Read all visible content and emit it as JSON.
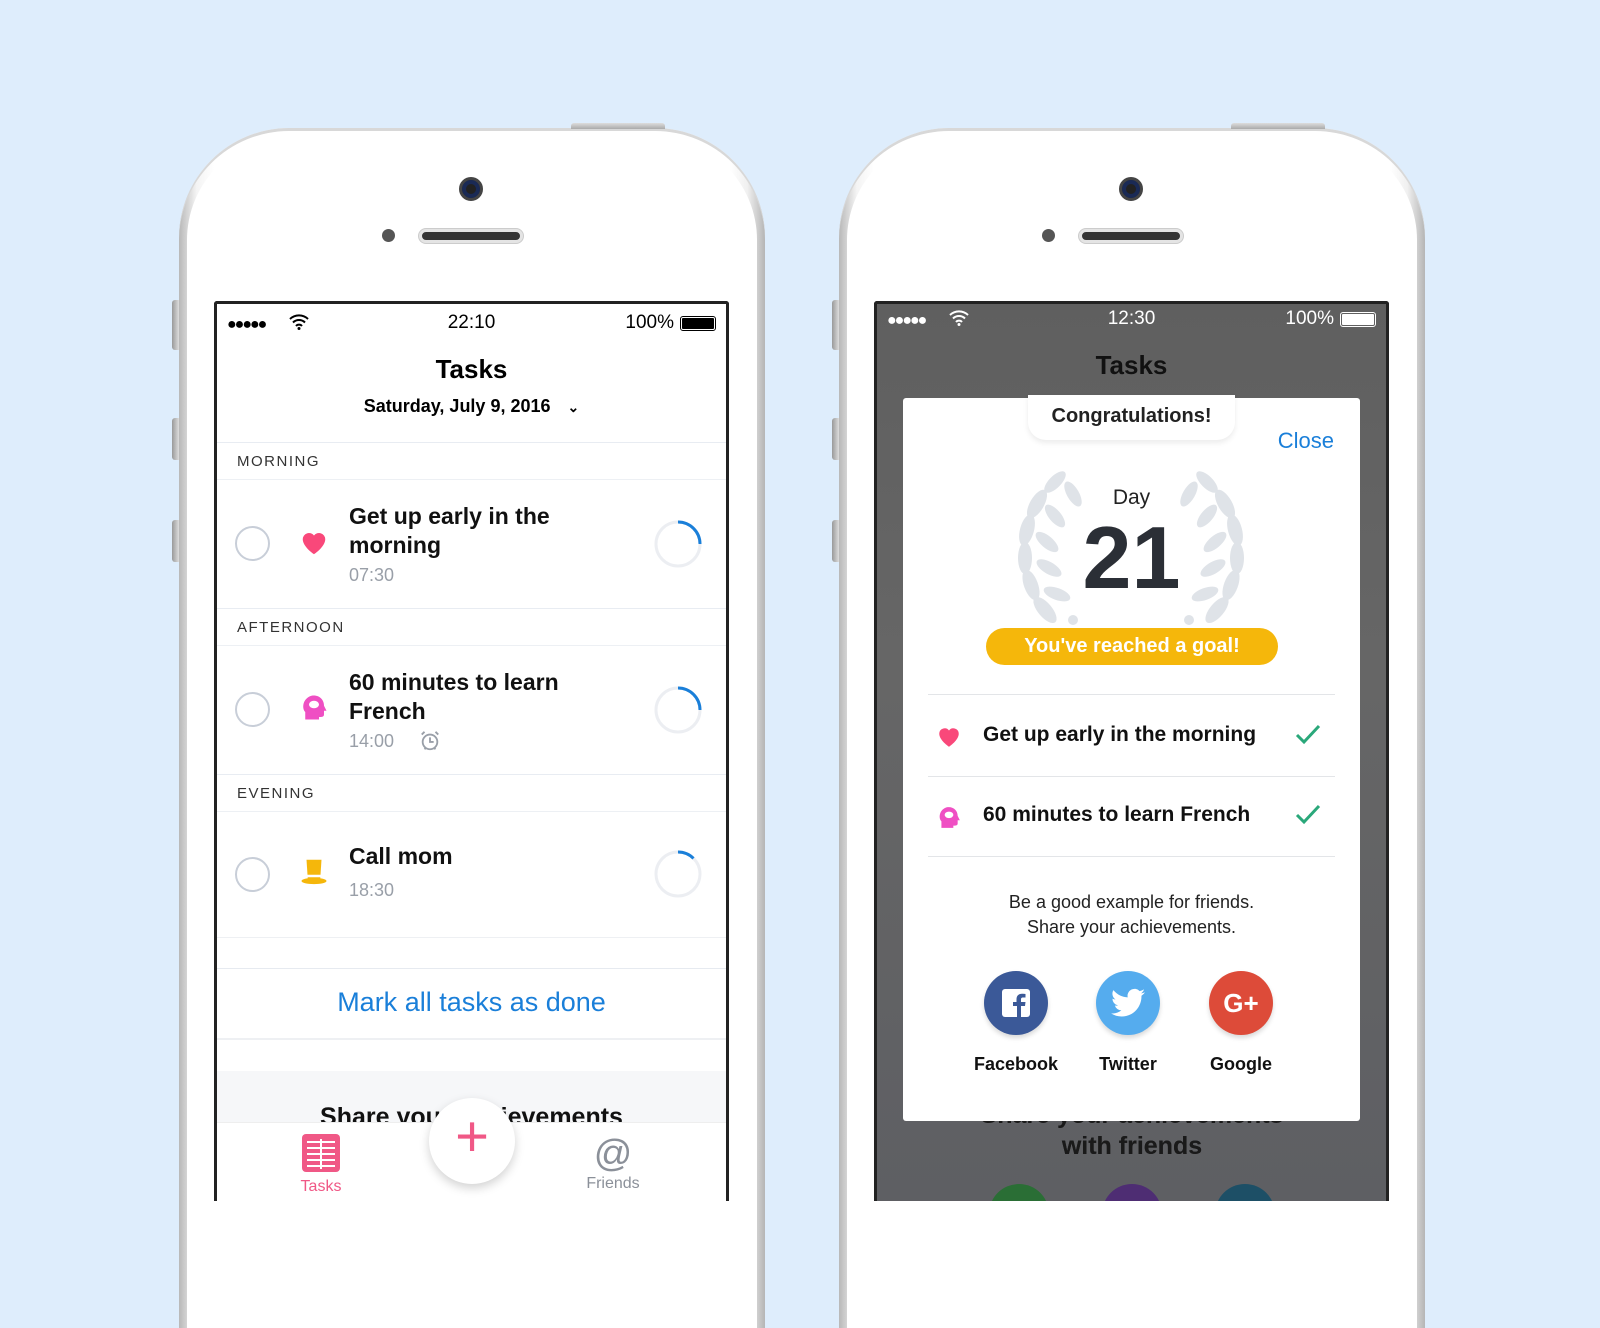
{
  "colors": {
    "accent": "#1a7fd9",
    "pink": "#f05886",
    "goal": "#f5b70b",
    "check": "#2aa87a",
    "facebook": "#3b5998",
    "twitter": "#55acee",
    "google": "#dd4b39"
  },
  "left": {
    "status": {
      "time": "22:10",
      "battery": "100%"
    },
    "title": "Tasks",
    "date": "Saturday, July 9, 2016",
    "sections": [
      {
        "label": "MORNING",
        "task": {
          "name": "Get up early in the morning",
          "time": "07:30",
          "icon": "heart-icon"
        }
      },
      {
        "label": "AFTERNOON",
        "task": {
          "name": "60 minutes to learn French",
          "time": "14:00",
          "icon": "head-icon",
          "alarm": true
        }
      },
      {
        "label": "EVENING",
        "task": {
          "name": "Call mom",
          "time": "18:30",
          "icon": "hat-icon"
        }
      }
    ],
    "mark_all": "Mark all tasks as done",
    "share_heading": "Share your achievements",
    "tabs": {
      "tasks": "Tasks",
      "friends": "Friends"
    }
  },
  "right": {
    "status": {
      "time": "12:30",
      "battery": "100%"
    },
    "title": "Tasks",
    "bg_share": "Share your achievements with friends",
    "bg_share_visible": "with friends",
    "modal": {
      "badge": "Congratulations!",
      "close": "Close",
      "day_label": "Day",
      "day_number": "21",
      "goal": "You've reached a goal!",
      "tasks": [
        {
          "name": "Get up early in the morning",
          "done": true
        },
        {
          "name": "60 minutes to learn French",
          "done": true
        }
      ],
      "message_line1": "Be a good example for friends.",
      "message_line2": "Share your achievements.",
      "share": [
        {
          "label": "Facebook",
          "icon": "facebook-icon"
        },
        {
          "label": "Twitter",
          "icon": "twitter-icon"
        },
        {
          "label": "Google",
          "icon": "google-plus-icon"
        }
      ]
    }
  }
}
